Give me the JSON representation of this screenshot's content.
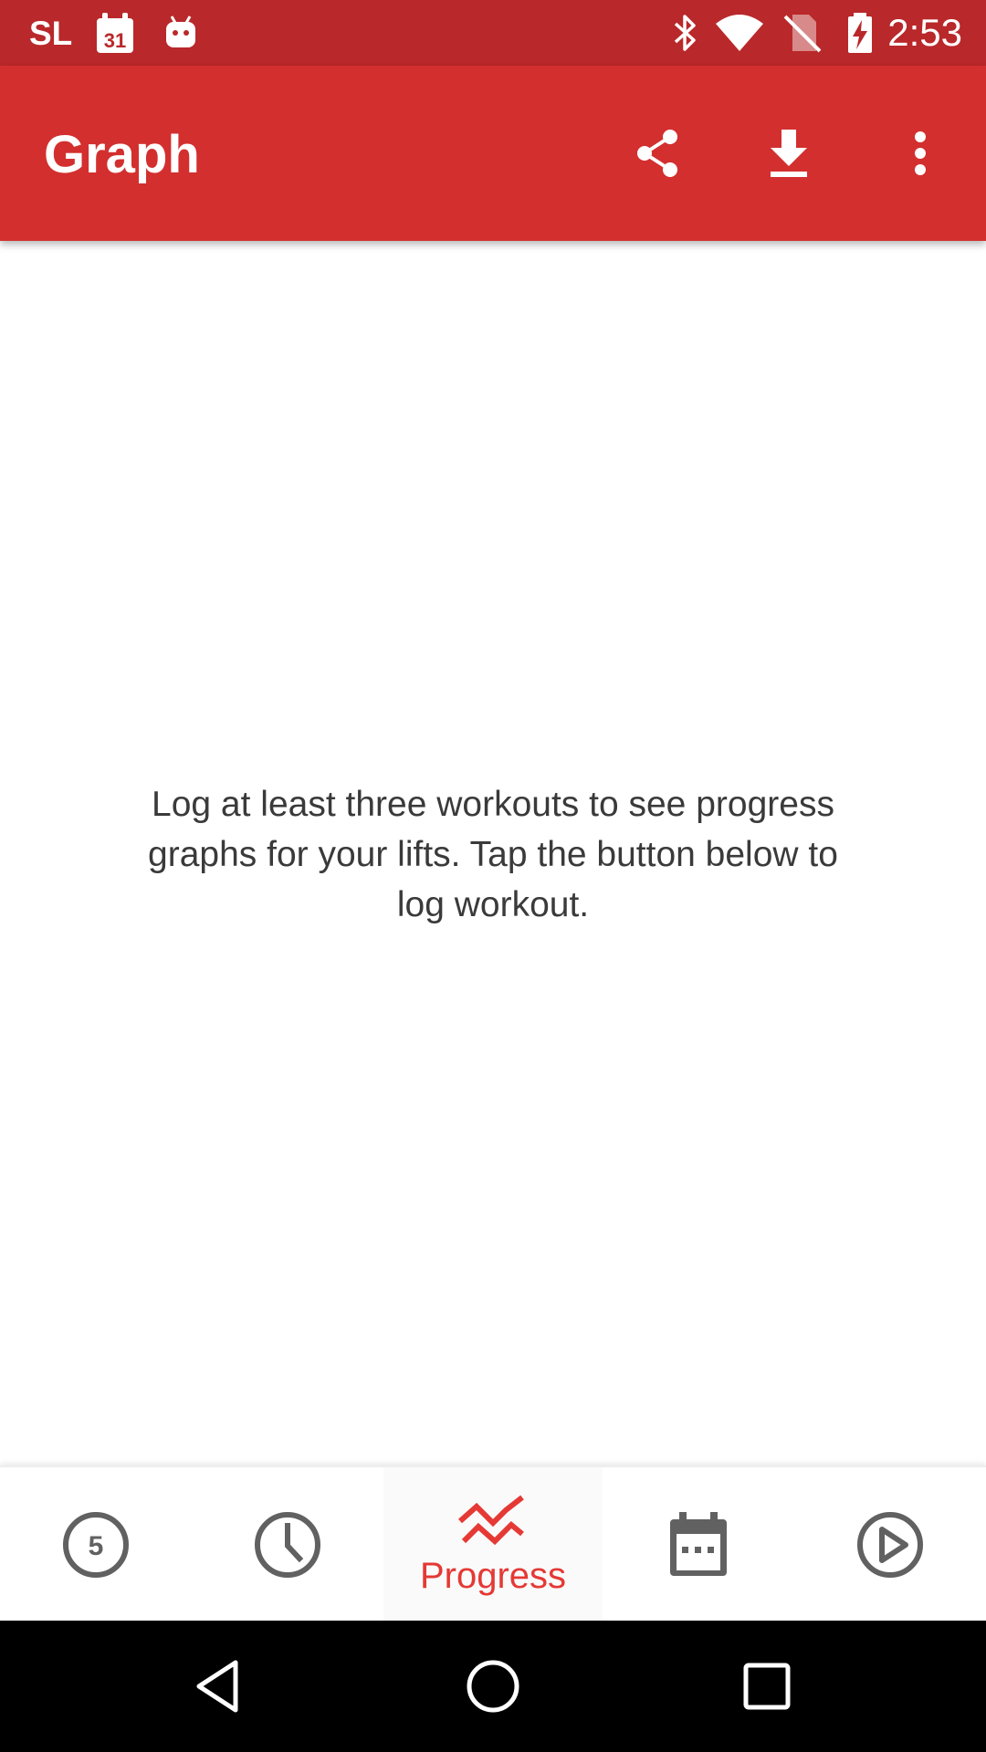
{
  "status_bar": {
    "carrier": "SL",
    "calendar_day": "31",
    "time": "2:53",
    "icons": [
      "calendar-icon",
      "android-icon",
      "bluetooth-icon",
      "wifi-icon",
      "no-sim-icon",
      "battery-charging-icon"
    ]
  },
  "app_bar": {
    "title": "Graph",
    "actions": [
      "share-icon",
      "download-icon",
      "more-vert-icon"
    ]
  },
  "content": {
    "empty_message": "Log at least three workouts to see progress graphs for your lifts. Tap the button below to log workout."
  },
  "bottom_nav": {
    "items": [
      {
        "icon": "five-circle-icon",
        "icon_text": "5",
        "label": ""
      },
      {
        "icon": "clock-icon",
        "label": ""
      },
      {
        "icon": "progress-chart-icon",
        "label": "Progress",
        "active": true
      },
      {
        "icon": "calendar-icon",
        "label": ""
      },
      {
        "icon": "play-circle-icon",
        "label": ""
      }
    ]
  },
  "colors": {
    "status_bar": "#b9282a",
    "app_bar": "#d32f2f",
    "accent": "#e53935",
    "inactive_icon": "#616161",
    "text": "#3a3a3a"
  }
}
